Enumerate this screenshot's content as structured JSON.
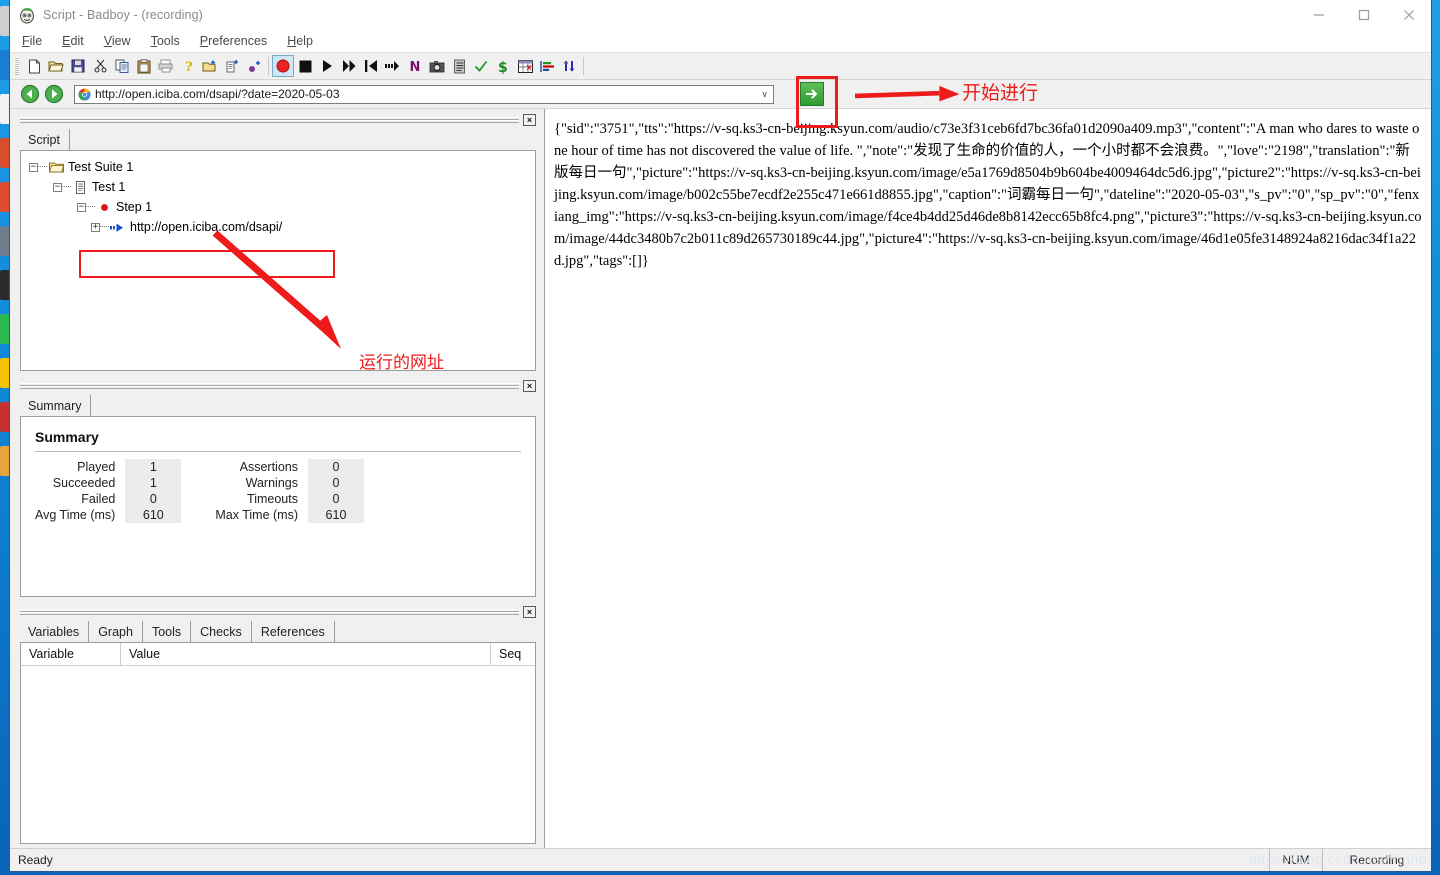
{
  "window": {
    "title": "Script - Badboy - (recording)",
    "app_icon": "badboy-face-icon",
    "minimize_label": "Minimize",
    "maximize_label": "Maximize",
    "close_label": "Close"
  },
  "menu": [
    {
      "pre": "",
      "accel": "F",
      "post": "ile"
    },
    {
      "pre": "",
      "accel": "E",
      "post": "dit"
    },
    {
      "pre": "",
      "accel": "V",
      "post": "iew"
    },
    {
      "pre": "",
      "accel": "T",
      "post": "ools"
    },
    {
      "pre": "",
      "accel": "P",
      "post": "references"
    },
    {
      "pre": "",
      "accel": "H",
      "post": "elp"
    }
  ],
  "toolbar": {
    "buttons": [
      {
        "name": "new-icon"
      },
      {
        "name": "open-folder-icon"
      },
      {
        "name": "save-icon"
      },
      {
        "name": "cut-scissors-icon"
      },
      {
        "name": "copy-icon"
      },
      {
        "name": "paste-icon"
      },
      {
        "name": "print-icon"
      },
      {
        "name": "help-question-icon"
      },
      {
        "name": "add-suite-icon"
      },
      {
        "name": "add-test-icon"
      },
      {
        "name": "add-step-icon"
      },
      {
        "name": "record-icon",
        "active": true
      },
      {
        "name": "stop-icon"
      },
      {
        "name": "play-icon"
      },
      {
        "name": "play-all-icon"
      },
      {
        "name": "rewind-icon"
      },
      {
        "name": "step-icon"
      },
      {
        "name": "navigator-n-icon"
      },
      {
        "name": "screenshot-icon"
      },
      {
        "name": "report-icon"
      },
      {
        "name": "check-icon"
      },
      {
        "name": "dollar-variable-icon"
      },
      {
        "name": "grid-icon"
      },
      {
        "name": "chart-icon"
      },
      {
        "name": "refresh-icon"
      }
    ]
  },
  "urlbar": {
    "back_label": "Back",
    "forward_label": "Forward",
    "site_icon": "chrome-icon",
    "url": "http://open.iciba.com/dsapi/?date=2020-05-03",
    "dropdown_glyph": "∨",
    "go_label": "Go"
  },
  "annotations": {
    "go_button_note": "开始进行",
    "tree_note": "运行的网址",
    "highlight_color": "#ee1b1b"
  },
  "script_panel": {
    "tabs": [
      "Script"
    ],
    "close_glyph": "×",
    "tree": [
      {
        "label": "Test Suite 1",
        "icon": "folder-icon",
        "toggle": "−",
        "depth": 0
      },
      {
        "label": "Test 1",
        "icon": "test-document-icon",
        "toggle": "−",
        "depth": 1
      },
      {
        "label": "Step 1",
        "icon": "red-dot-icon",
        "toggle": "−",
        "depth": 2
      },
      {
        "label": "http://open.iciba.com/dsapi/",
        "icon": "navigate-arrow-icon",
        "toggle": "+",
        "depth": 3
      }
    ]
  },
  "summary_panel": {
    "tabs": [
      "Summary"
    ],
    "close_glyph": "×",
    "heading": "Summary",
    "left_rows": [
      {
        "label": "Played",
        "value": "1"
      },
      {
        "label": "Succeeded",
        "value": "1"
      },
      {
        "label": "Failed",
        "value": "0"
      },
      {
        "label": "Avg Time (ms)",
        "value": "610"
      }
    ],
    "right_rows": [
      {
        "label": "Assertions",
        "value": "0"
      },
      {
        "label": "Warnings",
        "value": "0"
      },
      {
        "label": "Timeouts",
        "value": "0"
      },
      {
        "label": "Max Time (ms)",
        "value": "610"
      }
    ]
  },
  "variables_panel": {
    "tabs": [
      "Variables",
      "Graph",
      "Tools",
      "Checks",
      "References"
    ],
    "close_glyph": "×",
    "columns": [
      "Variable",
      "Value",
      "Seq"
    ],
    "rows": []
  },
  "response_panel": {
    "body": "{\"sid\":\"3751\",\"tts\":\"https://v-sq.ks3-cn-beijing.ksyun.com/audio/c73e3f31ceb6fd7bc36fa01d2090a409.mp3\",\"content\":\"A man who dares to waste one hour of time has not discovered the value of life. \",\"note\":\"发现了生命的价值的人，一个小时都不会浪费。\",\"love\":\"2198\",\"translation\":\"新版每日一句\",\"picture\":\"https://v-sq.ks3-cn-beijing.ksyun.com/image/e5a1769d8504b9b604be4009464dc5d6.jpg\",\"picture2\":\"https://v-sq.ks3-cn-beijing.ksyun.com/image/b002c55be7ecdf2e255c471e661d8855.jpg\",\"caption\":\"词霸每日一句\",\"dateline\":\"2020-05-03\",\"s_pv\":\"0\",\"sp_pv\":\"0\",\"fenxiang_img\":\"https://v-sq.ks3-cn-beijing.ksyun.com/image/f4ce4b4dd25d46de8b8142ecc65b8fc4.png\",\"picture3\":\"https://v-sq.ks3-cn-beijing.ksyun.com/image/44dc3480b7c2b011c89d265730189c44.jpg\",\"picture4\":\"https://v-sq.ks3-cn-beijing.ksyun.com/image/46d1e05fe3148924a8216dac34f1a22d.jpg\",\"tags\":[]}"
  },
  "statusbar": {
    "status": "Ready",
    "num_indicator": "NUM",
    "recording_indicator": "Recording",
    "watermark": "https://blog.csdn.net/Yinhb"
  }
}
